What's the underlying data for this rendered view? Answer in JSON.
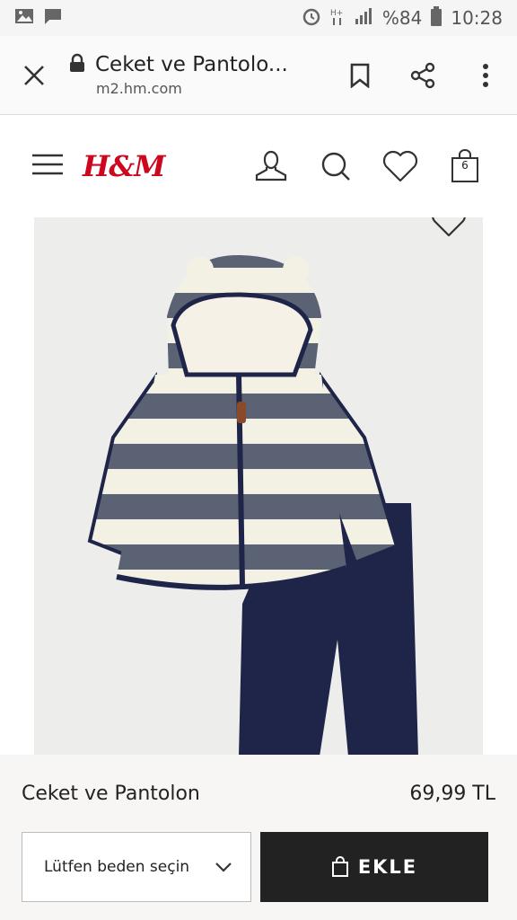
{
  "status_bar": {
    "battery": "%84",
    "time": "10:28"
  },
  "browser": {
    "page_title": "Ceket ve Pantolo...",
    "domain": "m2.hm.com"
  },
  "site": {
    "logo_text": "H&M",
    "bag_count": "6",
    "brand_color": "#cc071e"
  },
  "product": {
    "name": "Ceket ve Pantolon",
    "price": "69,99 TL",
    "size_placeholder": "Lütfen beden seçin",
    "add_label": "EKLE"
  }
}
